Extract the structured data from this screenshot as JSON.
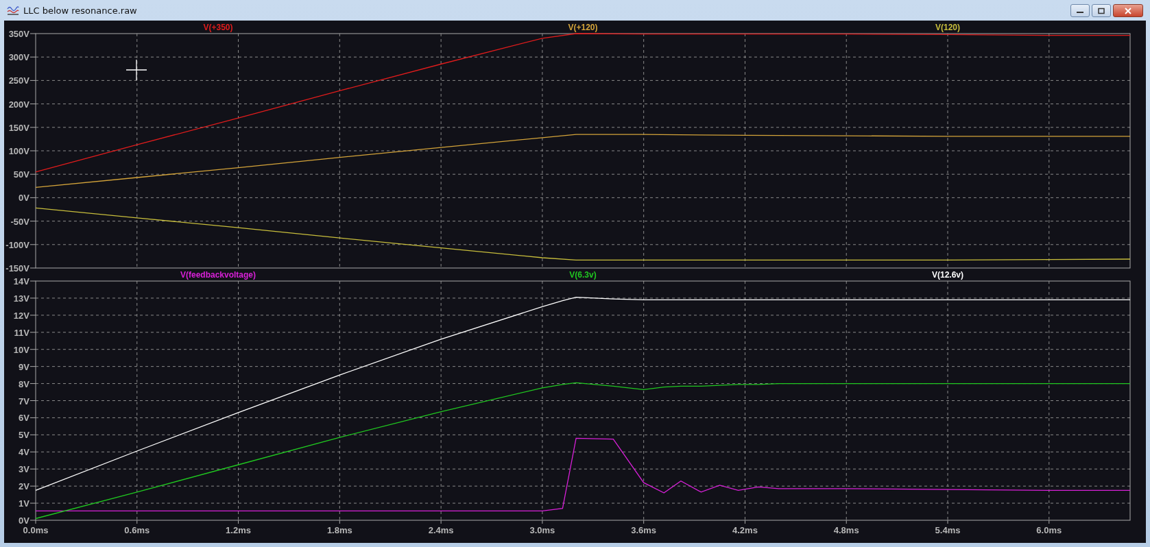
{
  "window": {
    "title": "LLC below resonance.raw"
  },
  "panes": [
    {
      "chart_data": {
        "type": "line",
        "grid": true,
        "x": [
          0,
          0.6,
          1.2,
          1.8,
          2.4,
          3.0,
          3.2,
          3.6,
          4.2,
          4.8,
          5.4,
          6.0,
          6.48
        ],
        "xlim": [
          0,
          6.48
        ],
        "ylim": [
          -150,
          350
        ],
        "yticks": [
          {
            "value": 350,
            "label": "350V"
          },
          {
            "value": 300,
            "label": "300V"
          },
          {
            "value": 250,
            "label": "250V"
          },
          {
            "value": 200,
            "label": "200V"
          },
          {
            "value": 150,
            "label": "150V"
          },
          {
            "value": 100,
            "label": "100V"
          },
          {
            "value": 50,
            "label": "50V"
          },
          {
            "value": 0,
            "label": "0V"
          },
          {
            "value": -50,
            "label": "-50V"
          },
          {
            "value": -100,
            "label": "-100V"
          },
          {
            "value": -150,
            "label": "-150V"
          }
        ],
        "series": [
          {
            "name": "V(+350)",
            "color": "#e01c1c",
            "values": [
              55,
              113,
              170,
              228,
              285,
              340,
              350,
              349,
              349,
              349,
              348,
              346,
              346
            ]
          },
          {
            "name": "V(+120)",
            "color": "#d4a43a",
            "values": [
              22,
              43,
              64,
              86,
              107,
              128,
              135,
              135,
              133,
              132,
              131,
              131,
              131
            ]
          },
          {
            "name": "V(120)",
            "color": "#c8be3c",
            "values": [
              -22,
              -43,
              -64,
              -86,
              -107,
              -128,
              -133,
              -133,
              -133,
              -133,
              -133,
              -132,
              -131
            ]
          }
        ]
      }
    },
    {
      "chart_data": {
        "type": "line",
        "grid": true,
        "x": [
          0,
          0.6,
          1.2,
          1.8,
          2.4,
          3.0,
          3.12,
          3.2,
          3.42,
          3.6,
          3.72,
          3.82,
          3.94,
          4.05,
          4.16,
          4.28,
          4.4,
          4.8,
          5.4,
          6.0,
          6.48
        ],
        "xlim": [
          0,
          6.48
        ],
        "ylim": [
          0,
          14
        ],
        "xticks": [
          {
            "value": 0,
            "label": "0.0ms"
          },
          {
            "value": 0.6,
            "label": "0.6ms"
          },
          {
            "value": 1.2,
            "label": "1.2ms"
          },
          {
            "value": 1.8,
            "label": "1.8ms"
          },
          {
            "value": 2.4,
            "label": "2.4ms"
          },
          {
            "value": 3.0,
            "label": "3.0ms"
          },
          {
            "value": 3.6,
            "label": "3.6ms"
          },
          {
            "value": 4.2,
            "label": "4.2ms"
          },
          {
            "value": 4.8,
            "label": "4.8ms"
          },
          {
            "value": 5.4,
            "label": "5.4ms"
          },
          {
            "value": 6.0,
            "label": "6.0ms"
          }
        ],
        "yticks": [
          {
            "value": 14,
            "label": "14V"
          },
          {
            "value": 13,
            "label": "13V"
          },
          {
            "value": 12,
            "label": "12V"
          },
          {
            "value": 11,
            "label": "11V"
          },
          {
            "value": 10,
            "label": "10V"
          },
          {
            "value": 9,
            "label": "9V"
          },
          {
            "value": 8,
            "label": "8V"
          },
          {
            "value": 7,
            "label": "7V"
          },
          {
            "value": 6,
            "label": "6V"
          },
          {
            "value": 5,
            "label": "5V"
          },
          {
            "value": 4,
            "label": "4V"
          },
          {
            "value": 3,
            "label": "3V"
          },
          {
            "value": 2,
            "label": "2V"
          },
          {
            "value": 1,
            "label": "1V"
          },
          {
            "value": 0,
            "label": "0V"
          }
        ],
        "series": [
          {
            "name": "V(feedbackvoltage)",
            "color": "#d820d8",
            "values": [
              0.55,
              0.55,
              0.55,
              0.55,
              0.55,
              0.55,
              0.7,
              4.8,
              4.75,
              2.2,
              1.6,
              2.3,
              1.65,
              2.05,
              1.75,
              1.95,
              1.85,
              1.85,
              1.8,
              1.75,
              1.75
            ]
          },
          {
            "name": "V(6.3v)",
            "color": "#20c820",
            "values": [
              0.1,
              1.65,
              3.25,
              4.85,
              6.35,
              7.75,
              7.95,
              8.05,
              7.85,
              7.65,
              7.8,
              7.85,
              7.85,
              7.9,
              7.95,
              7.95,
              8.0,
              8.0,
              8.0,
              8.0,
              8.0
            ]
          },
          {
            "name": "V(12.6v)",
            "color": "#ffffff",
            "values": [
              1.75,
              4.05,
              6.3,
              8.5,
              10.6,
              12.5,
              12.85,
              13.05,
              12.95,
              12.9,
              12.9,
              12.9,
              12.9,
              12.9,
              12.9,
              12.9,
              12.9,
              12.9,
              12.9,
              12.9,
              12.9
            ]
          }
        ]
      }
    }
  ]
}
